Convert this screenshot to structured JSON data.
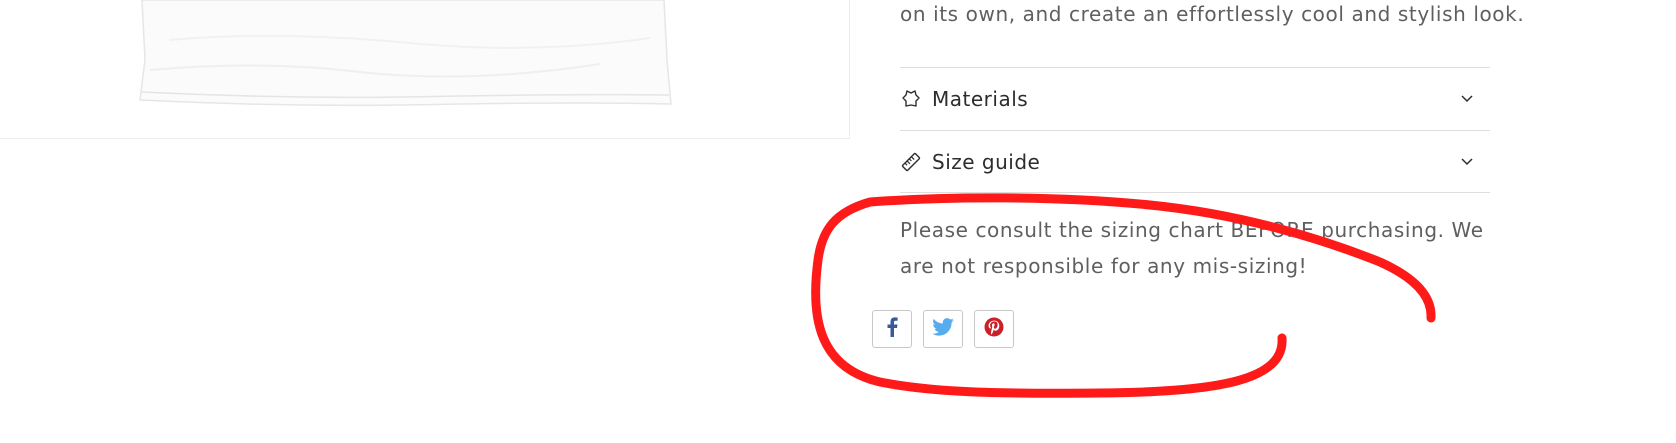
{
  "description": {
    "tail": "on its own, and create an effortlessly cool and stylish look."
  },
  "accordions": [
    {
      "label": "Materials",
      "icon": "leather-icon"
    },
    {
      "label": "Size guide",
      "icon": "ruler-icon"
    }
  ],
  "size_note": "Please consult the sizing chart BEFORE purchasing. We are not responsible for any mis-sizing!",
  "share": [
    {
      "icon": "facebook-icon",
      "color": "#3b5998"
    },
    {
      "icon": "twitter-icon",
      "color": "#55acee"
    },
    {
      "icon": "pinterest-icon",
      "color": "#cb2027"
    }
  ],
  "annotation_color": "#ff1a1a"
}
